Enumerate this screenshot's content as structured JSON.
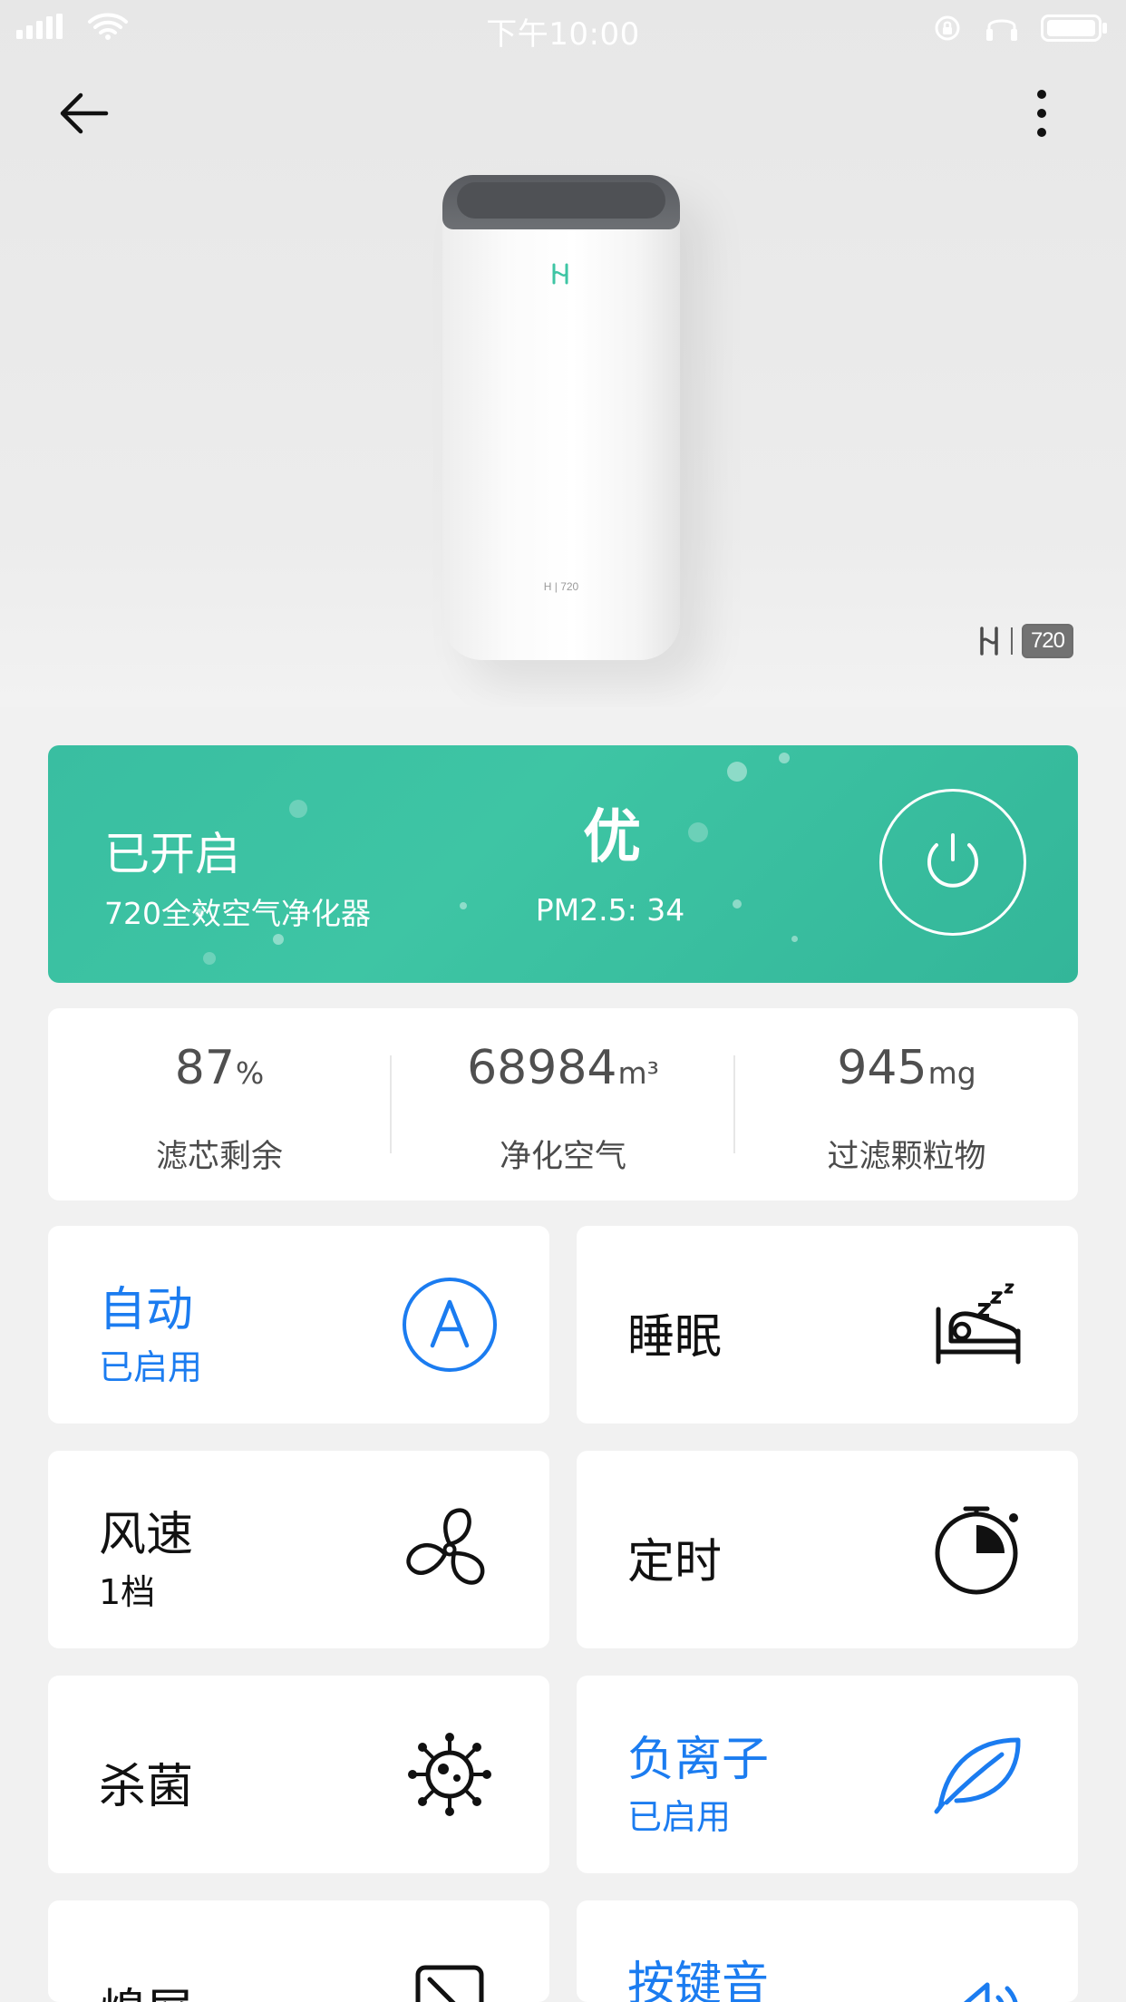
{
  "status_bar": {
    "time": "下午10:00"
  },
  "device": {
    "badge_small": "H | 720",
    "brand_box": "720"
  },
  "status_card": {
    "state": "已开启",
    "device_name": "720全效空气净化器",
    "air_quality": "优",
    "pm25": "PM2.5: 34"
  },
  "stats": [
    {
      "value": "87",
      "unit": "%",
      "label": "滤芯剩余"
    },
    {
      "value": "68984",
      "unit": "m³",
      "label": "净化空气"
    },
    {
      "value": "945",
      "unit": "mg",
      "label": "过滤颗粒物"
    }
  ],
  "controls": [
    {
      "title": "自动",
      "sub": "已启用",
      "icon": "auto-mode-icon"
    },
    {
      "title": "睡眠",
      "sub": "",
      "icon": "sleep-icon"
    },
    {
      "title": "风速",
      "sub": "1档",
      "icon": "fan-icon"
    },
    {
      "title": "定时",
      "sub": "",
      "icon": "timer-icon"
    },
    {
      "title": "杀菌",
      "sub": "",
      "icon": "sterilize-icon"
    },
    {
      "title": "负离子",
      "sub": "已启用",
      "icon": "leaf-icon"
    },
    {
      "title": "熄屏",
      "sub": "",
      "icon": "screen-off-icon"
    },
    {
      "title": "按键音",
      "sub": "",
      "icon": "speaker-icon"
    }
  ],
  "colors": {
    "teal": "#3ec5a4",
    "blue": "#1b7cf0"
  }
}
